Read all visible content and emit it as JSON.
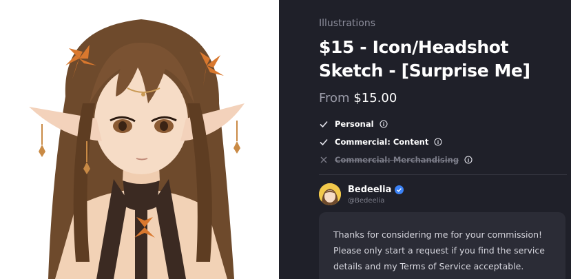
{
  "product": {
    "category": "Illustrations",
    "title": "$15 - Icon/Headshot Sketch - [Surprise Me]",
    "price_prefix": "From",
    "price": "$15.00"
  },
  "licenses": [
    {
      "label": "Personal",
      "available": true
    },
    {
      "label": "Commercial: Content",
      "available": true
    },
    {
      "label": "Commercial: Merchandising",
      "available": false
    }
  ],
  "seller": {
    "name": "Bedeelia",
    "handle": "@Bedeelia",
    "verified": true
  },
  "message": "Thanks for considering me for your commission! Please only start a request if you find the service details and my Terms of Service acceptable.",
  "icons": {
    "check": "check-icon",
    "cross": "x-icon",
    "info": "info-icon",
    "verified": "verified-badge-icon"
  },
  "colors": {
    "background": "#1f2029",
    "card": "#2b2c36",
    "muted_text": "#8d8e9c",
    "verified": "#3b82f6",
    "hair": "#6e4a2c",
    "leaves": "#d9782e"
  }
}
